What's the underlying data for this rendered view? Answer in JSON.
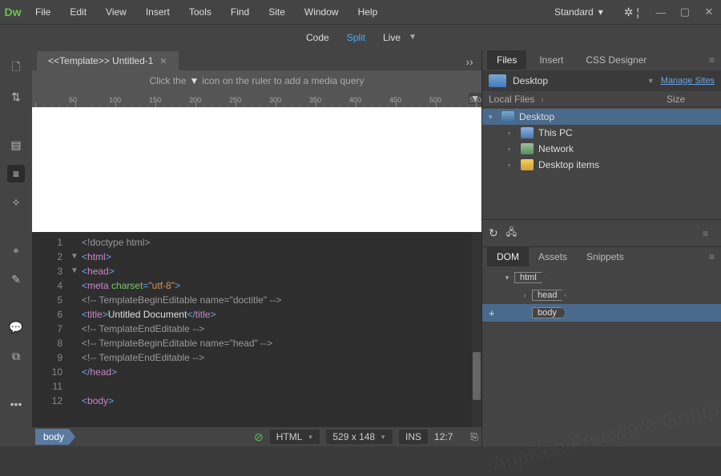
{
  "titlebar": {
    "logo": "Dw",
    "menu": [
      "File",
      "Edit",
      "View",
      "Insert",
      "Tools",
      "Find",
      "Site",
      "Window",
      "Help"
    ],
    "workspace": "Standard"
  },
  "viewbar": {
    "code": "Code",
    "split": "Split",
    "live": "Live"
  },
  "tab": {
    "title": "<<Template>> Untitled-1"
  },
  "hint": {
    "pre": "Click the",
    "post": "icon on the ruler to add a media query"
  },
  "ruler_ticks": [
    "",
    "50",
    "100",
    "150",
    "200",
    "250",
    "300",
    "350",
    "400",
    "450",
    "500",
    "550"
  ],
  "code": {
    "lines": [
      {
        "n": "1",
        "fold": "",
        "tokens": [
          [
            "tk-gray",
            "<!doctype html>"
          ]
        ]
      },
      {
        "n": "2",
        "fold": "▼",
        "tokens": [
          [
            "tk-blue",
            "<"
          ],
          [
            "tk-pink",
            "html"
          ],
          [
            "tk-blue",
            ">"
          ]
        ]
      },
      {
        "n": "3",
        "fold": "▼",
        "tokens": [
          [
            "tk-blue",
            "<"
          ],
          [
            "tk-pink",
            "head"
          ],
          [
            "tk-blue",
            ">"
          ]
        ]
      },
      {
        "n": "4",
        "fold": "",
        "tokens": [
          [
            "tk-blue",
            "<"
          ],
          [
            "tk-pink",
            "meta"
          ],
          [
            "tk-white",
            " "
          ],
          [
            "tk-green",
            "charset"
          ],
          [
            "tk-blue",
            "="
          ],
          [
            "tk-orange",
            "\"utf-8\""
          ],
          [
            "tk-blue",
            ">"
          ]
        ]
      },
      {
        "n": "5",
        "fold": "",
        "tokens": [
          [
            "tk-gray",
            "<!-- TemplateBeginEditable name=\"doctitle\" -->"
          ]
        ]
      },
      {
        "n": "6",
        "fold": "",
        "tokens": [
          [
            "tk-blue",
            "<"
          ],
          [
            "tk-pink",
            "title"
          ],
          [
            "tk-blue",
            ">"
          ],
          [
            "tk-white",
            "Untitled Document"
          ],
          [
            "tk-blue",
            "</"
          ],
          [
            "tk-pink",
            "title"
          ],
          [
            "tk-blue",
            ">"
          ]
        ]
      },
      {
        "n": "7",
        "fold": "",
        "tokens": [
          [
            "tk-gray",
            "<!-- TemplateEndEditable -->"
          ]
        ]
      },
      {
        "n": "8",
        "fold": "",
        "tokens": [
          [
            "tk-gray",
            "<!-- TemplateBeginEditable name=\"head\" -->"
          ]
        ]
      },
      {
        "n": "9",
        "fold": "",
        "tokens": [
          [
            "tk-gray",
            "<!-- TemplateEndEditable -->"
          ]
        ]
      },
      {
        "n": "10",
        "fold": "",
        "tokens": [
          [
            "tk-blue",
            "</"
          ],
          [
            "tk-pink",
            "head"
          ],
          [
            "tk-blue",
            ">"
          ]
        ]
      },
      {
        "n": "11",
        "fold": "",
        "tokens": [
          [
            "tk-white",
            ""
          ]
        ]
      },
      {
        "n": "12",
        "fold": "",
        "tokens": [
          [
            "tk-blue",
            "<"
          ],
          [
            "tk-pink",
            "body"
          ],
          [
            "tk-blue",
            ">"
          ]
        ]
      }
    ]
  },
  "statusbar": {
    "crumb": "body",
    "lang": "HTML",
    "size": "529 x 148",
    "ins": "INS",
    "pos": "12:7"
  },
  "panels": {
    "files_tabs": [
      "Files",
      "Insert",
      "CSS Designer"
    ],
    "site": "Desktop",
    "manage": "Manage Sites",
    "headers": {
      "name": "Local Files",
      "size": "Size"
    },
    "tree": [
      {
        "chev": "▾",
        "icon": "desktop-icon",
        "label": "Desktop",
        "indent": 0,
        "sel": true
      },
      {
        "chev": "›",
        "icon": "pc-icon",
        "label": "This PC",
        "indent": 1
      },
      {
        "chev": "›",
        "icon": "net-icon",
        "label": "Network",
        "indent": 1
      },
      {
        "chev": "›",
        "icon": "folder-icon",
        "label": "Desktop items",
        "indent": 1
      }
    ],
    "dom_tabs": [
      "DOM",
      "Assets",
      "Snippets"
    ],
    "dom_tree": [
      {
        "chev": "▾",
        "tag": "html",
        "indent": 0
      },
      {
        "chev": "›",
        "tag": "head",
        "indent": 1
      },
      {
        "chev": "",
        "tag": "body",
        "indent": 1,
        "sel": true,
        "plus": true
      }
    ]
  },
  "watermark": "AppNee\nFreeware\nGroup"
}
